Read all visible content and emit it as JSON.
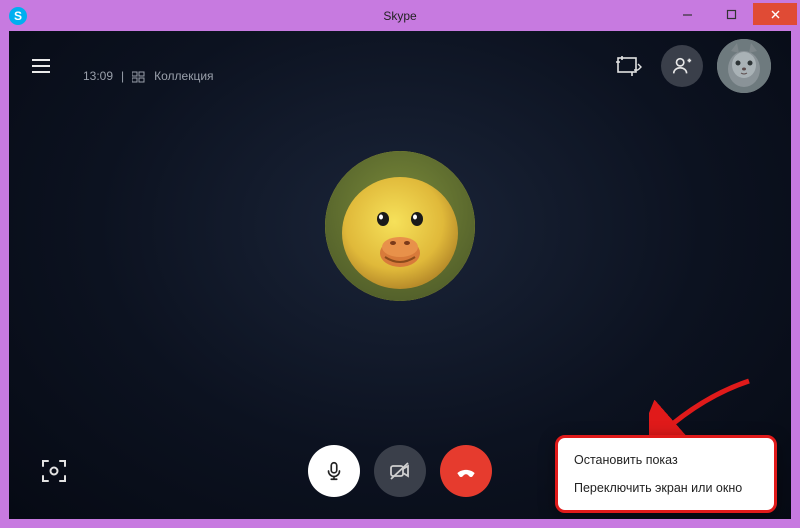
{
  "window": {
    "title": "Skype",
    "app_icon_letter": "S"
  },
  "topbar": {
    "time": "13:09",
    "collection_label": "Коллекция"
  },
  "context_menu": {
    "stop_sharing": "Остановить показ",
    "switch_screen": "Переключить экран или окно"
  }
}
